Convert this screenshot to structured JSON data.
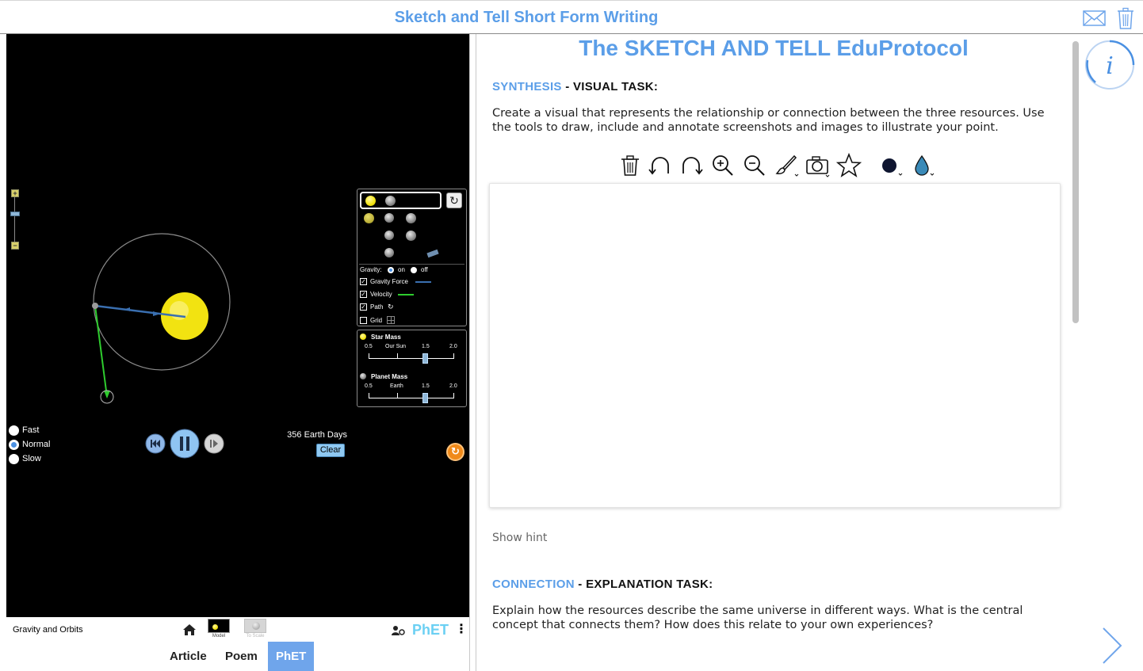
{
  "header": {
    "title": "Sketch and Tell Short Form Writing",
    "mail_icon": "mail-icon",
    "trash_icon": "trash-icon"
  },
  "sim": {
    "name": "Gravity and Orbits",
    "gravity_label": "Gravity:",
    "gravity_on": "on",
    "gravity_off": "off",
    "checkboxes": [
      {
        "label": "Gravity Force",
        "checked": true
      },
      {
        "label": "Velocity",
        "checked": true
      },
      {
        "label": "Path",
        "checked": true
      },
      {
        "label": "Grid",
        "checked": false
      }
    ],
    "star_mass": {
      "title": "Star Mass",
      "ticks": [
        "0.5",
        "Our Sun",
        "1.5",
        "2.0"
      ],
      "value": 1.5
    },
    "planet_mass": {
      "title": "Planet Mass",
      "ticks": [
        "0.5",
        "Earth",
        "1.5",
        "2.0"
      ],
      "value": 1.5
    },
    "speeds": [
      {
        "label": "Fast",
        "selected": false
      },
      {
        "label": "Normal",
        "selected": true
      },
      {
        "label": "Slow",
        "selected": false
      }
    ],
    "elapsed": "356 Earth Days",
    "clear_label": "Clear",
    "screens": [
      {
        "label": "Model"
      },
      {
        "label": "To Scale"
      }
    ],
    "logo": "PhET",
    "colors": {
      "sun": "#f2e311",
      "gravity_vector": "#3a6fb0",
      "velocity_vector": "#2ecc2e",
      "accent": "#5b9ee8"
    }
  },
  "tabs": [
    {
      "label": "Article"
    },
    {
      "label": "Poem"
    },
    {
      "label": "PhET",
      "active": true
    }
  ],
  "doc": {
    "title": "The SKETCH AND TELL EduProtocol",
    "synthesis": {
      "accent": "SYNTHESIS",
      "rest": " - VISUAL TASK:"
    },
    "synthesis_text": "Create a visual that represents the relationship or connection between the three resources. Use the tools to draw, include and annotate screenshots and images to illustrate your point.",
    "tools": [
      "trash-icon",
      "undo-icon",
      "redo-icon",
      "zoom-in-icon",
      "zoom-out-icon",
      "brush-icon",
      "camera-icon",
      "star-icon",
      "color-dot-icon",
      "fill-drop-icon"
    ],
    "hint": "Show hint",
    "connection": {
      "accent": "CONNECTION",
      "rest": " - EXPLANATION TASK:"
    },
    "connection_text": "Explain how the resources describe the same universe in different ways. What is the central concept that connects them? How does this relate to your own experiences?"
  }
}
